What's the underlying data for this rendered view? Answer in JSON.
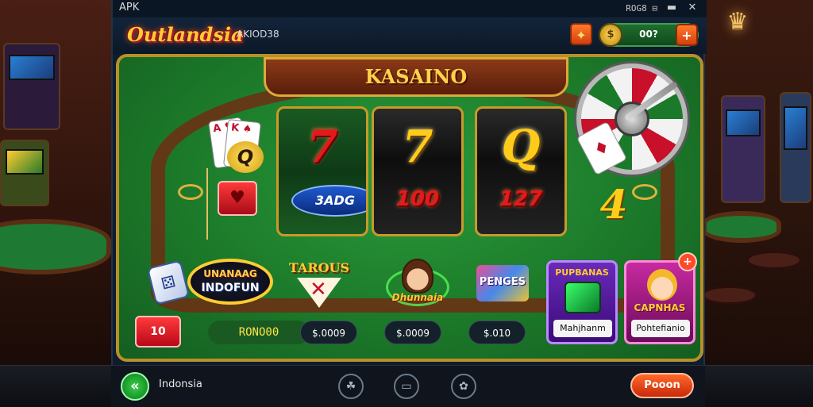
{
  "window": {
    "tag": "APK",
    "status_text": "ROG8 ⊟",
    "controls": {
      "minimize": "▬",
      "close": "✕"
    }
  },
  "header": {
    "logo_text": "Outlandsia",
    "subtitle": "AKIOD38",
    "gift_button": "✦",
    "coin_icon": "$",
    "coin_balance": "00?",
    "coin_plus": "+"
  },
  "table": {
    "banner_title": "KASAINO",
    "card_symbol": "Q",
    "card_corner_1": "A ♥",
    "card_corner_2": "K ♠",
    "heart_chip": "♥",
    "wheel_card": "♦",
    "reels": [
      {
        "top": "7",
        "bottom": "3ADG"
      },
      {
        "top": "7",
        "bottom": "100"
      },
      {
        "top": "Q",
        "bottom": "127"
      }
    ],
    "side_symbol": "4"
  },
  "games": [
    {
      "id": "indofun",
      "line1": "UNANAAG",
      "line2": "INDOFUN"
    },
    {
      "id": "tarot",
      "line1": "TAROUS"
    },
    {
      "id": "girl",
      "line1": "Dhunnaia"
    },
    {
      "id": "pengs",
      "line1": "PENGES"
    },
    {
      "id": "mahjong",
      "line1": "PUPBANAS",
      "label": "Mahjhanm"
    },
    {
      "id": "princess",
      "line1": "CAPNHAS",
      "label": "Pohtefianio"
    }
  ],
  "badge_plus": "+",
  "dice_face": "⚄",
  "controls_row": {
    "red_button": "10",
    "player_name": "RONO00",
    "bets": [
      "$.0009",
      "$.0009",
      "$.010"
    ]
  },
  "bottom": {
    "back_icon": "«",
    "region": "Indonsia",
    "nav_icons": [
      "☘",
      "▭",
      "✿"
    ],
    "action_label": "Pooon"
  },
  "colors": {
    "felt": "#1c7a2a",
    "gold_trim": "#b8902a",
    "accent_orange": "#d4400e"
  }
}
